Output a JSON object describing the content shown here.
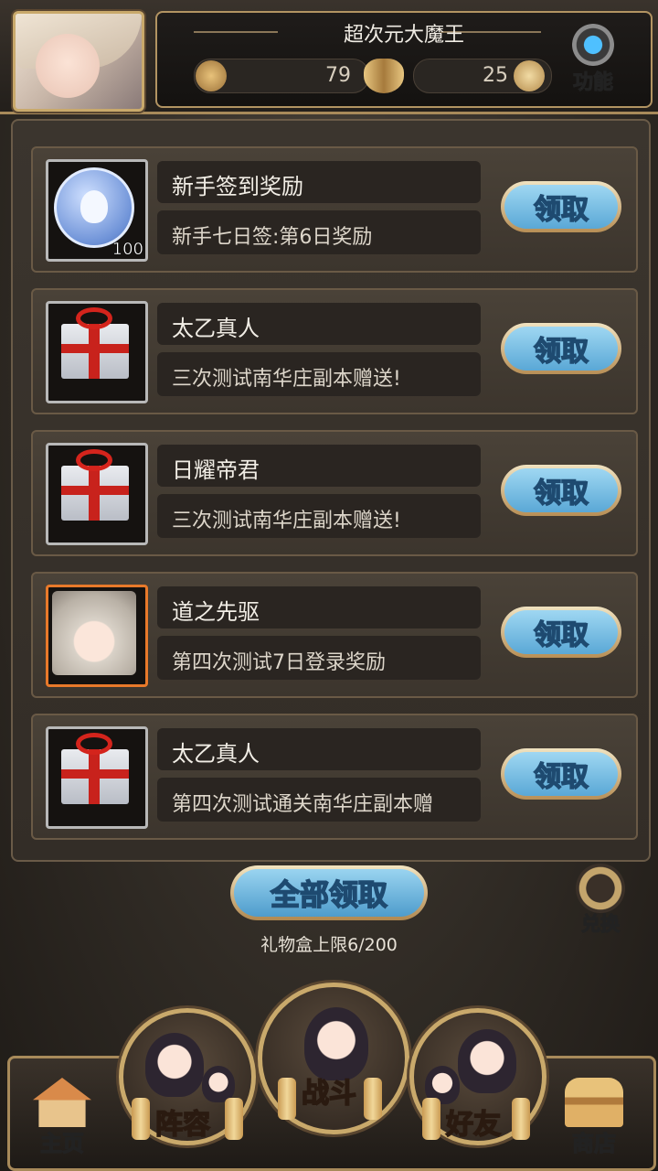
{
  "header": {
    "player_name": "超次元大魔王",
    "resource1_value": "79",
    "resource2_value": "25",
    "function_label": "功能"
  },
  "gifts": [
    {
      "title": "新手签到奖励",
      "description": "新手七日签:第6日奖励",
      "item": "coin",
      "count": "100",
      "claim_label": "领取"
    },
    {
      "title": "太乙真人",
      "description": "三次测试南华庄副本赠送!",
      "item": "gift",
      "count": "",
      "claim_label": "领取"
    },
    {
      "title": "日耀帝君",
      "description": "三次测试南华庄副本赠送!",
      "item": "gift",
      "count": "",
      "claim_label": "领取"
    },
    {
      "title": "道之先驱",
      "description": "第四次测试7日登录奖励",
      "item": "portrait",
      "count": "",
      "claim_label": "领取"
    },
    {
      "title": "太乙真人",
      "description": "第四次测试通关南华庄副本赠",
      "item": "gift",
      "count": "",
      "claim_label": "领取"
    }
  ],
  "claim_all_label": "全部领取",
  "limit_text": "礼物盒上限6/200",
  "exchange_label": "兑换",
  "nav": {
    "home": "主页",
    "lineup": "阵容",
    "battle": "战斗",
    "friends": "好友",
    "shop": "商店"
  },
  "colors": {
    "claim_blue": "#5aa8d6",
    "gold_border": "#c9a96b",
    "panel_bg": "#3b352e"
  }
}
